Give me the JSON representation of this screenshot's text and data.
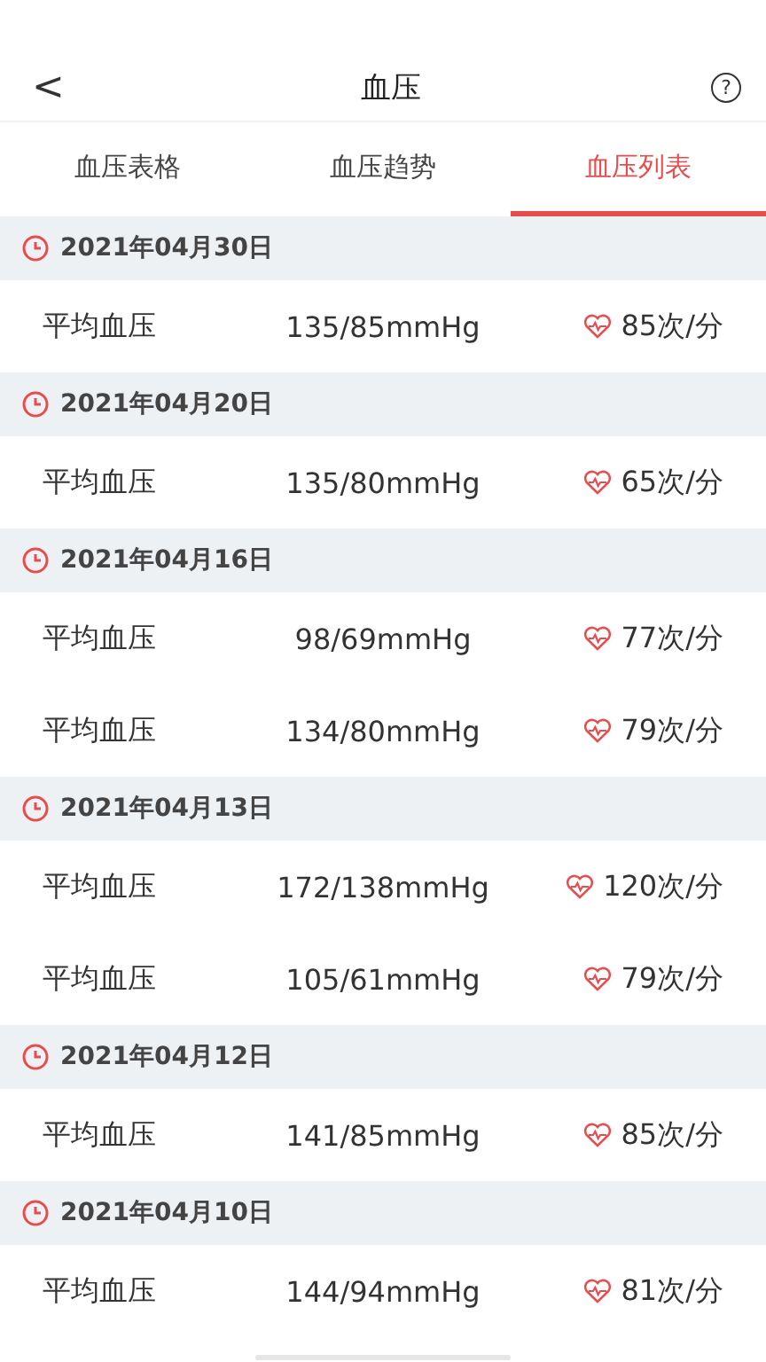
{
  "header": {
    "back": "<",
    "title": "血压",
    "help": "?"
  },
  "tabs": [
    {
      "label": "血压表格",
      "selected": false
    },
    {
      "label": "血压趋势",
      "selected": false
    },
    {
      "label": "血压列表",
      "selected": true
    }
  ],
  "groups": [
    {
      "date": "2021年04月30日",
      "rows": [
        {
          "label": "平均血压",
          "pressure": "135/85mmHg",
          "pulse": "85次/分"
        }
      ]
    },
    {
      "date": "2021年04月20日",
      "rows": [
        {
          "label": "平均血压",
          "pressure": "135/80mmHg",
          "pulse": "65次/分"
        }
      ]
    },
    {
      "date": "2021年04月16日",
      "rows": [
        {
          "label": "平均血压",
          "pressure": "98/69mmHg",
          "pulse": "77次/分"
        },
        {
          "label": "平均血压",
          "pressure": "134/80mmHg",
          "pulse": "79次/分"
        }
      ]
    },
    {
      "date": "2021年04月13日",
      "rows": [
        {
          "label": "平均血压",
          "pressure": "172/138mmHg",
          "pulse": "120次/分"
        },
        {
          "label": "平均血压",
          "pressure": "105/61mmHg",
          "pulse": "79次/分"
        }
      ]
    },
    {
      "date": "2021年04月12日",
      "rows": [
        {
          "label": "平均血压",
          "pressure": "141/85mmHg",
          "pulse": "85次/分"
        }
      ]
    },
    {
      "date": "2021年04月10日",
      "rows": [
        {
          "label": "平均血压",
          "pressure": "144/94mmHg",
          "pulse": "81次/分"
        }
      ]
    }
  ]
}
